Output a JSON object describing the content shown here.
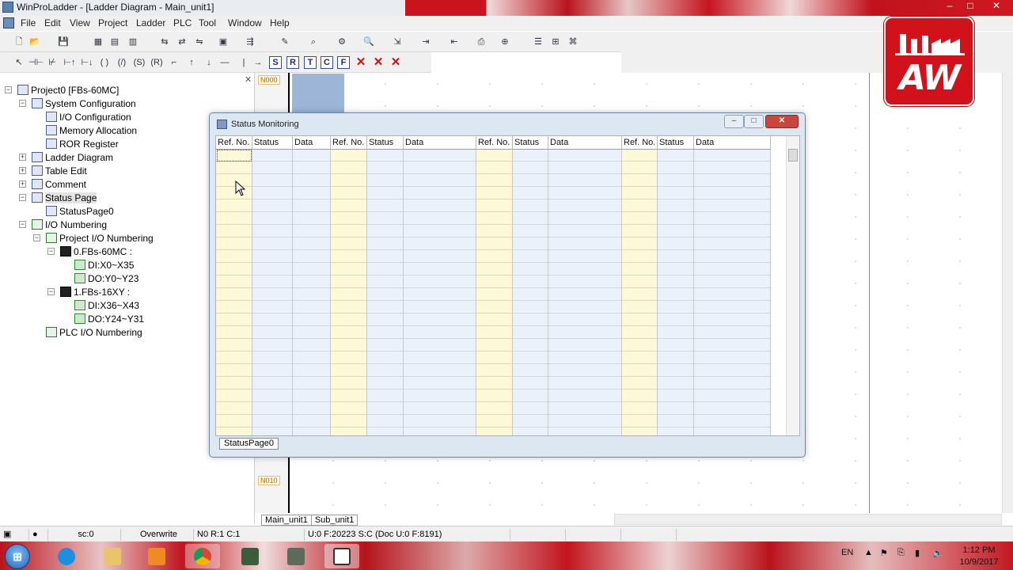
{
  "window": {
    "title": "WinProLadder - [Ladder Diagram - Main_unit1]",
    "min": "–",
    "max": "□",
    "close": "✕"
  },
  "menu": [
    "File",
    "Edit",
    "View",
    "Project",
    "Ladder",
    "PLC",
    "Tool",
    "Window",
    "Help"
  ],
  "toolbar2_letters": [
    "S",
    "R",
    "T",
    "C",
    "F"
  ],
  "tree": {
    "close": "✕",
    "nodes": [
      {
        "label": "Project0 [FBs-60MC]",
        "icon": "project-icon"
      },
      {
        "label": "System Configuration",
        "icon": "config-icon"
      },
      {
        "label": "I/O Configuration",
        "icon": "io-config-icon"
      },
      {
        "label": "Memory Allocation",
        "icon": "memory-icon"
      },
      {
        "label": "ROR Register",
        "icon": "register-icon"
      },
      {
        "label": "Ladder Diagram",
        "icon": "ladder-icon"
      },
      {
        "label": "Table Edit",
        "icon": "table-icon"
      },
      {
        "label": "Comment",
        "icon": "comment-icon"
      },
      {
        "label": "Status Page",
        "icon": "status-page-icon"
      },
      {
        "label": "StatusPage0",
        "icon": "page-icon"
      },
      {
        "label": "I/O Numbering",
        "icon": "io-numbering-icon"
      },
      {
        "label": "Project I/O Numbering",
        "icon": "io-numbering-icon"
      },
      {
        "label": "0.FBs-60MC :",
        "icon": "plc-module-icon"
      },
      {
        "label": "DI:X0~X35",
        "icon": "digital-input-icon"
      },
      {
        "label": "DO:Y0~Y23",
        "icon": "digital-output-icon"
      },
      {
        "label": "1.FBs-16XY :",
        "icon": "plc-module-icon"
      },
      {
        "label": "DI:X36~X43",
        "icon": "digital-input-icon"
      },
      {
        "label": "DO:Y24~Y31",
        "icon": "digital-output-icon"
      },
      {
        "label": "PLC I/O Numbering",
        "icon": "io-numbering-icon"
      }
    ]
  },
  "editor": {
    "rung_top": "N000",
    "rung_bottom": "N010",
    "tabs": [
      "Main_unit1",
      "Sub_unit1"
    ]
  },
  "dialog": {
    "title": "Status Monitoring",
    "columns": [
      "Ref. No.",
      "Status",
      "Data",
      "Ref. No.",
      "Status",
      "Data",
      "Ref. No.",
      "Status",
      "Data",
      "Ref. No.",
      "Status",
      "Data"
    ],
    "sheet_tab": "StatusPage0"
  },
  "statusbar": {
    "connection": "sc:0",
    "mode": "Overwrite",
    "position": "N0 R:1 C:1",
    "memory": "U:0 F:20223 S:C (Doc U:0 F:8191)"
  },
  "logo": {
    "text": "AW"
  },
  "taskbar": {
    "apps": [
      "windows-start",
      "internet-explorer",
      "file-explorer",
      "media-player",
      "chrome",
      "app-1",
      "app-2",
      "winproladder"
    ],
    "lang": "EN",
    "time": "1:12 PM",
    "date": "10/9/2017"
  },
  "colors": {
    "accent_red": "#c9141d",
    "ref_col": "#fdf9d8",
    "data_col": "#eaf1fb",
    "selection": "#9db5d6"
  }
}
